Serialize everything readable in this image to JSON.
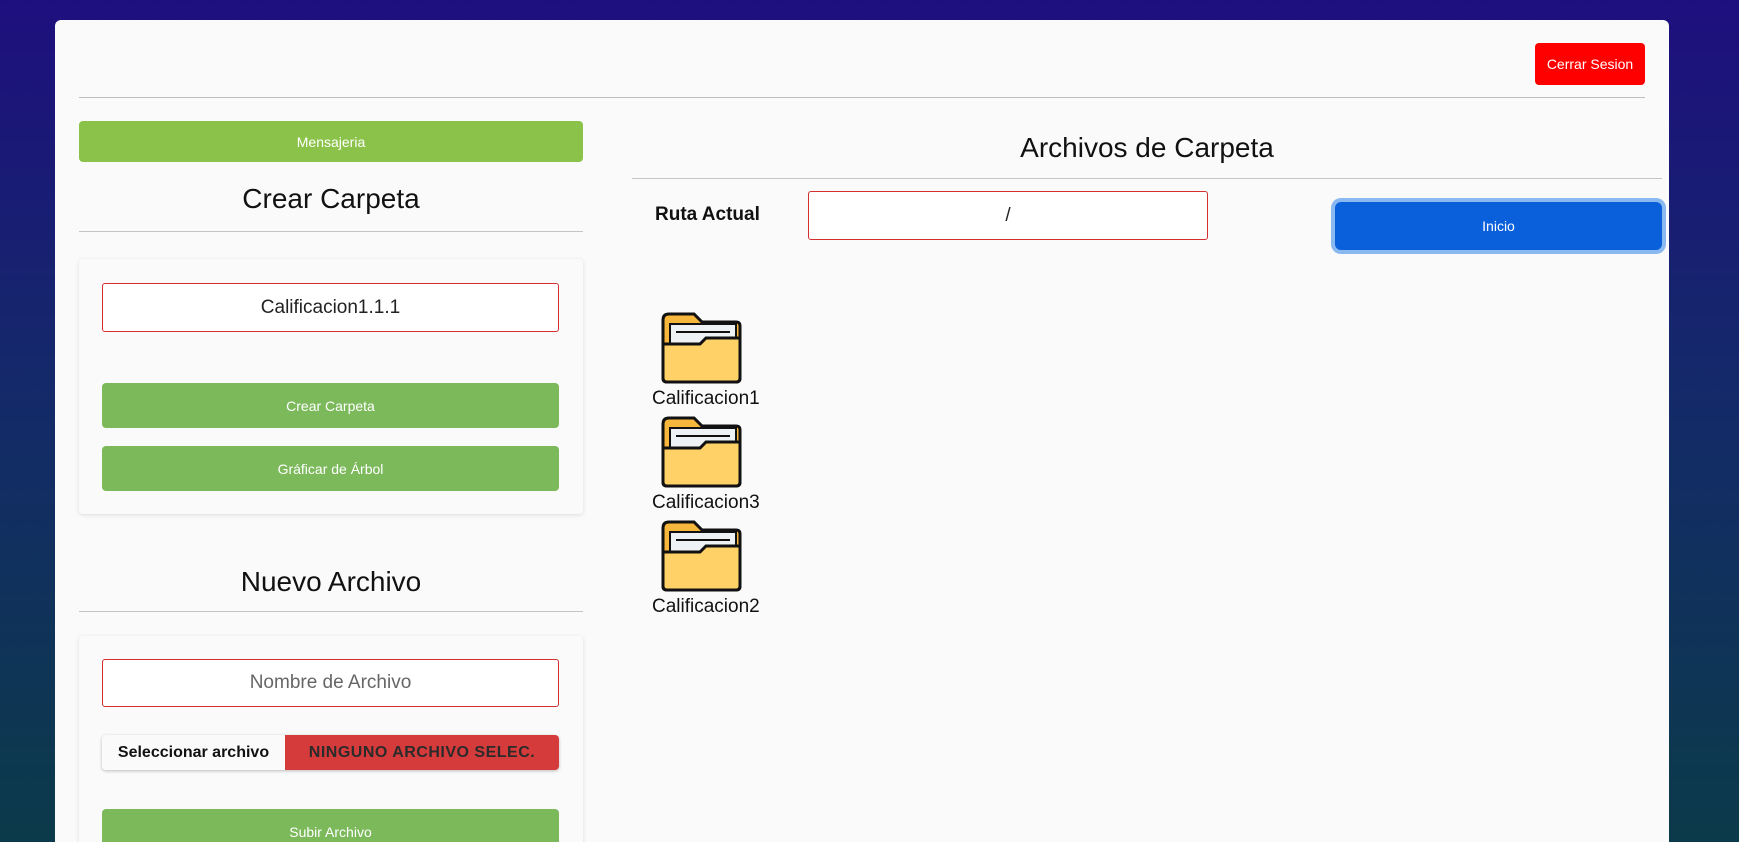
{
  "header": {
    "logout_label": "Cerrar Sesion"
  },
  "sidebar": {
    "messaging_label": "Mensajeria",
    "create_folder": {
      "title": "Crear Carpeta",
      "input_value": "Calificacion1.1.1",
      "create_button": "Crear Carpeta",
      "graph_button": "Gráficar de Árbol"
    },
    "new_file": {
      "title": "Nuevo Archivo",
      "name_placeholder": "Nombre de Archivo",
      "select_file_label": "Seleccionar archivo",
      "no_file_label": "NINGUNO ARCHIVO SELEC.",
      "upload_button": "Subir Archivo"
    }
  },
  "main": {
    "title": "Archivos de Carpeta",
    "path_label": "Ruta Actual",
    "path_value": "/",
    "home_button": "Inicio",
    "folders": [
      {
        "name": "Calificacion1"
      },
      {
        "name": "Calificacion3"
      },
      {
        "name": "Calificacion2"
      }
    ]
  },
  "colors": {
    "logout": "#ff0000",
    "green": "#8bc34a",
    "blue": "#0a5fdb",
    "error_red": "#d63b3b",
    "folder": "#ffd166"
  }
}
